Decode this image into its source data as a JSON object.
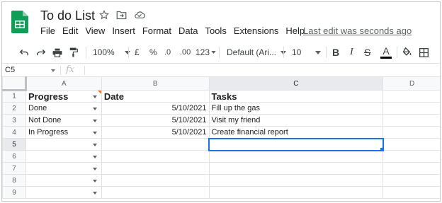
{
  "doc": {
    "title": "To do List",
    "last_edit": "Last edit was seconds ago"
  },
  "menu": [
    "File",
    "Edit",
    "View",
    "Insert",
    "Format",
    "Data",
    "Tools",
    "Extensions",
    "Help"
  ],
  "toolbar": {
    "zoom": "100%",
    "currency": "£",
    "percent": "%",
    "dec_decrease": ".0",
    "dec_increase": ".00",
    "format_more": "123",
    "font": "Default (Ari...",
    "font_size": "10",
    "bold": "B",
    "italic": "I",
    "strike": "S",
    "text_color": "A"
  },
  "formula_bar": {
    "cell_ref": "C5",
    "fx": "fx"
  },
  "grid": {
    "columns": [
      "A",
      "B",
      "C",
      "D"
    ],
    "rows": [
      "1",
      "2",
      "3",
      "4",
      "5",
      "6",
      "7",
      "8",
      "9"
    ],
    "header": {
      "a": "Progress",
      "b": "Date",
      "c": "Tasks"
    },
    "data": [
      {
        "a": "Done",
        "b": "5/10/2021",
        "c": "Fill up the gas"
      },
      {
        "a": "Not Done",
        "b": "5/10/2021",
        "c": "Visit my friend"
      },
      {
        "a": "In Progress",
        "b": "5/10/2021",
        "c": "Create financial report"
      }
    ]
  },
  "colors": {
    "accent": "#1a73e8",
    "sheets_green": "#0f9d58",
    "dropdown_marker": "#f4762d"
  }
}
